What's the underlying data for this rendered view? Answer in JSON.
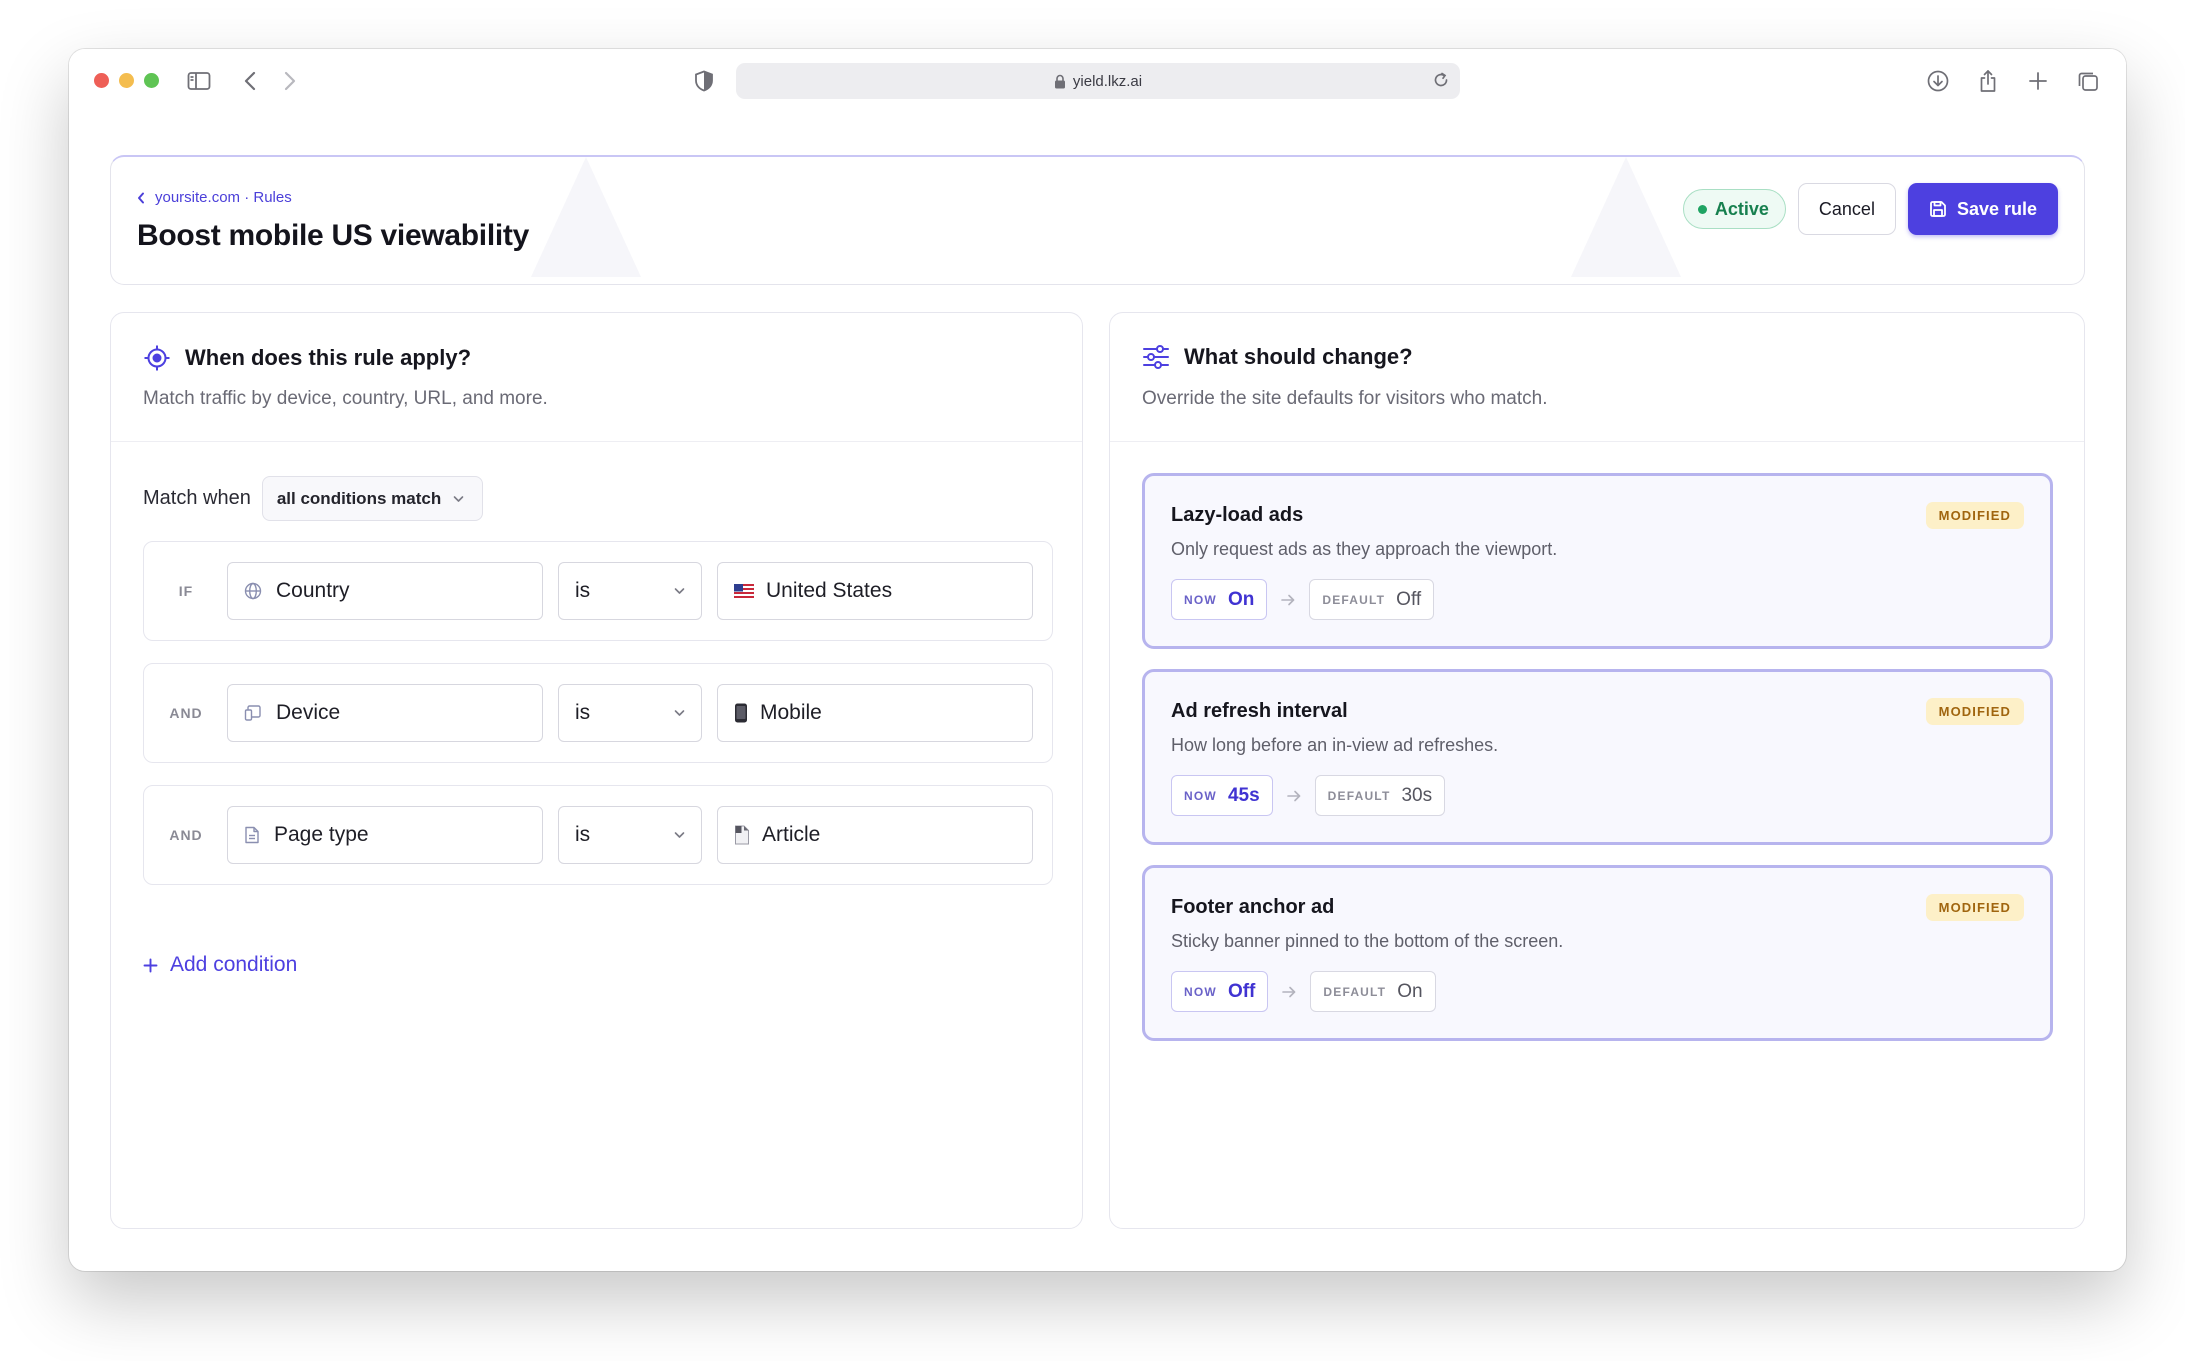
{
  "browser": {
    "url": "yield.lkz.ai"
  },
  "header": {
    "breadcrumb": "yoursite.com · Rules",
    "title": "Boost mobile US viewability",
    "status": "Active",
    "cancel_label": "Cancel",
    "save_label": "Save rule"
  },
  "conditions_panel": {
    "title": "When does this rule apply?",
    "subtitle": "Match traffic by device, country, URL, and more.",
    "match_label": "Match when",
    "match_value": "all conditions match",
    "conditions": [
      {
        "keyword": "IF",
        "field": "Country",
        "field_icon": "globe-icon",
        "operator": "is",
        "value": "United States",
        "value_icon": "us-flag-icon"
      },
      {
        "keyword": "AND",
        "field": "Device",
        "field_icon": "devices-icon",
        "operator": "is",
        "value": "Mobile",
        "value_icon": "mobile-phone-icon"
      },
      {
        "keyword": "AND",
        "field": "Page type",
        "field_icon": "document-icon",
        "operator": "is",
        "value": "Article",
        "value_icon": "page-icon"
      }
    ],
    "add_condition_label": "Add condition"
  },
  "changes_panel": {
    "title": "What should change?",
    "subtitle": "Override the site defaults for visitors who match.",
    "now_label": "NOW",
    "default_label": "DEFAULT",
    "changes": [
      {
        "title": "Lazy-load ads",
        "description": "Only request ads as they approach the viewport.",
        "badge": "MODIFIED",
        "now": "On",
        "default": "Off"
      },
      {
        "title": "Ad refresh interval",
        "description": "How long before an in-view ad refreshes.",
        "badge": "MODIFIED",
        "now": "45s",
        "default": "30s"
      },
      {
        "title": "Footer anchor ad",
        "description": "Sticky banner pinned to the bottom of the screen.",
        "badge": "MODIFIED",
        "now": "Off",
        "default": "On"
      }
    ]
  },
  "colors": {
    "accent": "#4d40e0",
    "active": "#1fa463",
    "modified": "#a0650f"
  }
}
